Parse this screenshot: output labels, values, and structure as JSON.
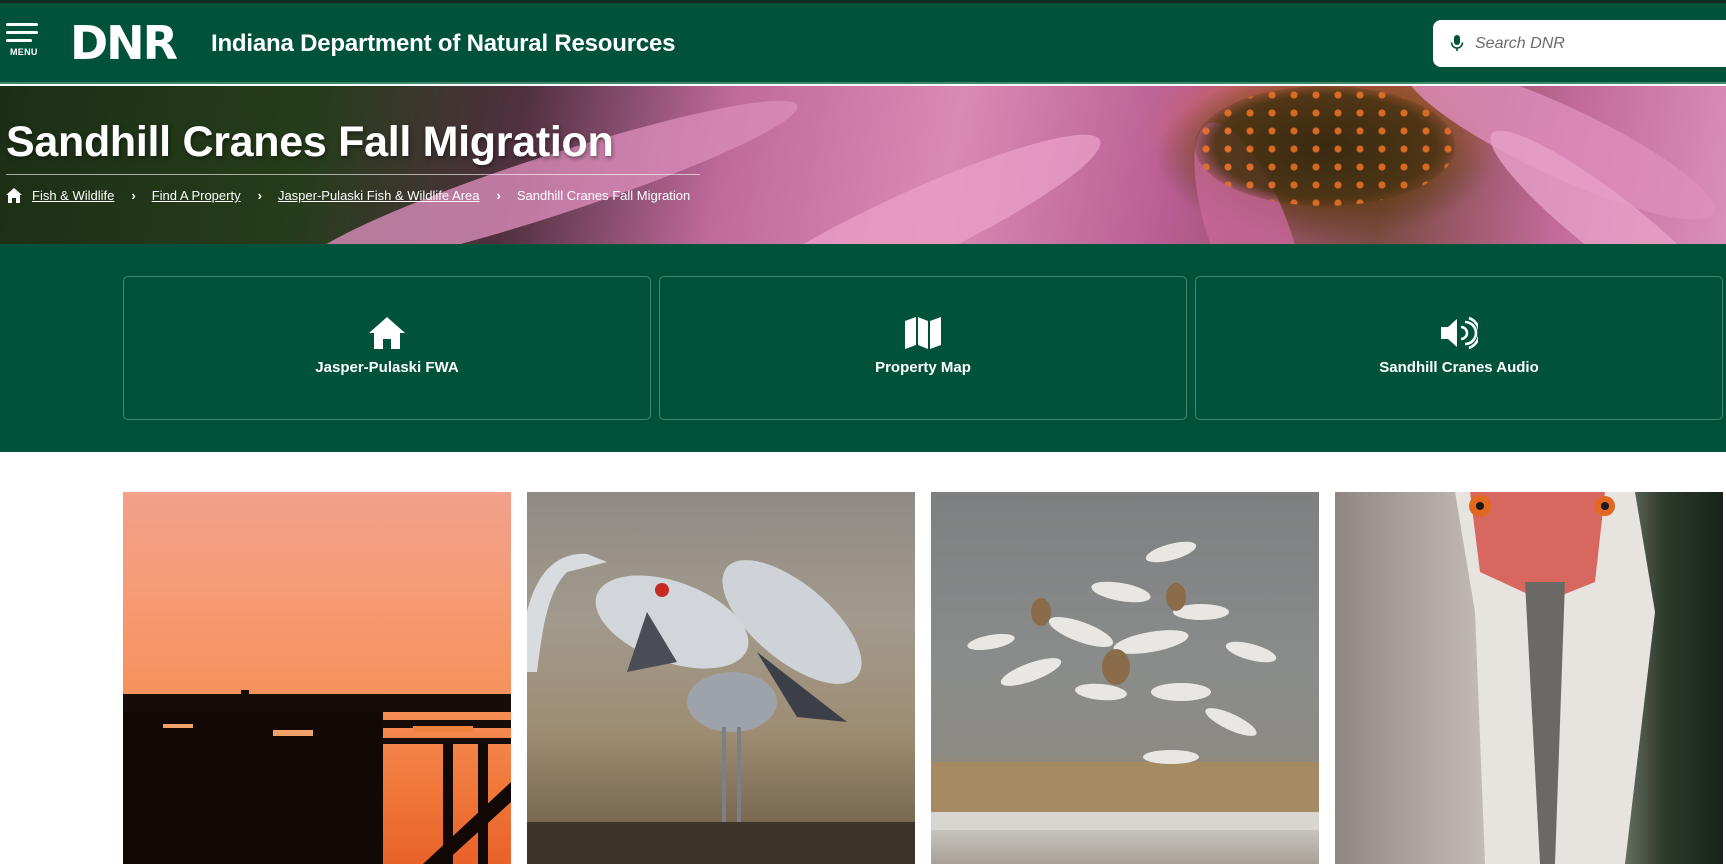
{
  "header": {
    "menu_label": "MENU",
    "logo_text": "DNR",
    "site_title": "Indiana Department of Natural Resources",
    "search": {
      "placeholder": "Search DNR",
      "icon": "microphone-icon"
    }
  },
  "hero": {
    "title": "Sandhill Cranes Fall Migration",
    "breadcrumbs": [
      {
        "label": "Fish & Wildlife",
        "link": true
      },
      {
        "label": "Find A Property",
        "link": true
      },
      {
        "label": "Jasper-Pulaski Fish & Wildlife Area",
        "link": true
      },
      {
        "label": "Sandhill Cranes Fall Migration",
        "link": false
      }
    ]
  },
  "quick_links": [
    {
      "label": "Jasper-Pulaski FWA",
      "icon": "home-icon"
    },
    {
      "label": "Property Map",
      "icon": "map-icon"
    },
    {
      "label": "Sandhill Cranes Audio",
      "icon": "volume-icon"
    }
  ],
  "colors": {
    "brand_green": "#00533a",
    "card_border": "#3f8a6c",
    "text_on_brand": "#ffffff"
  }
}
